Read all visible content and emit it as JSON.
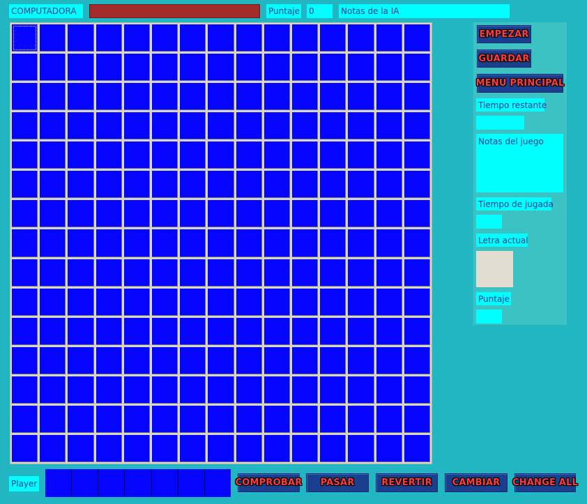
{
  "header": {
    "opponent_label": "COMPUTADORA",
    "score_label": "Puntaje",
    "score_value": "0",
    "ai_notes_label": "Notas de la IA"
  },
  "colors": {
    "background": "#21b6c2",
    "board_cell": "#0505ff",
    "label_bg": "#00ffff",
    "progress_fill": "#a52a2a",
    "button_bg": "#1a3f8f",
    "button_text": "#ff3b3b",
    "current_letter_bg": "#e2ddd0"
  },
  "board": {
    "rows": 15,
    "cols": 15,
    "selected_cell": "1,1"
  },
  "sidebar": {
    "start_button": "EMPEZAR",
    "save_button": "GUARDAR",
    "main_menu_button": "MENU PRINCIPAL",
    "time_remaining_label": "Tiempo restante",
    "game_notes_label": "Notas del juego",
    "turn_time_label": "Tiempo de jugada",
    "current_letter_label": "Letra actual",
    "score_label": "Puntaje"
  },
  "footer": {
    "player_label": "Player",
    "rack_slots": 7,
    "check_button": "COMPROBAR",
    "pass_button": "PASAR",
    "revert_button": "REVERTIR",
    "swap_button": "CAMBIAR",
    "change_all_button": "CHANGE ALL"
  }
}
